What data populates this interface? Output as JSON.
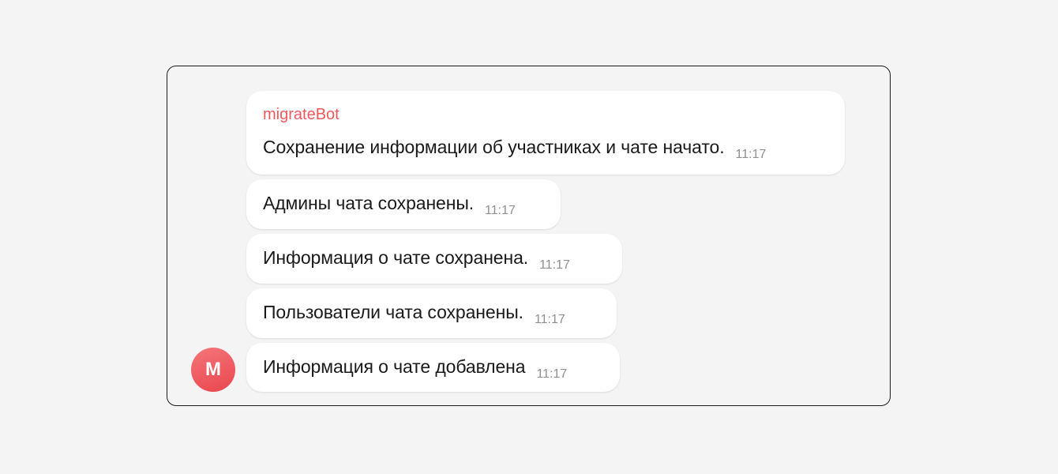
{
  "chat": {
    "sender_name": "migrateBot",
    "sender_color": "#ea5a5f",
    "avatar_letter": "M",
    "avatar_color": "#ee555b",
    "messages": [
      {
        "text": "Сохранение информации об участниках и чате начато.",
        "time": "11:17"
      },
      {
        "text": "Админы чата сохранены.",
        "time": "11:17"
      },
      {
        "text": "Информация о чате сохранена.",
        "time": "11:17"
      },
      {
        "text": "Пользователи чата сохранены.",
        "time": "11:17"
      },
      {
        "text": "Информация о чате добавлена",
        "time": "11:17"
      }
    ]
  }
}
